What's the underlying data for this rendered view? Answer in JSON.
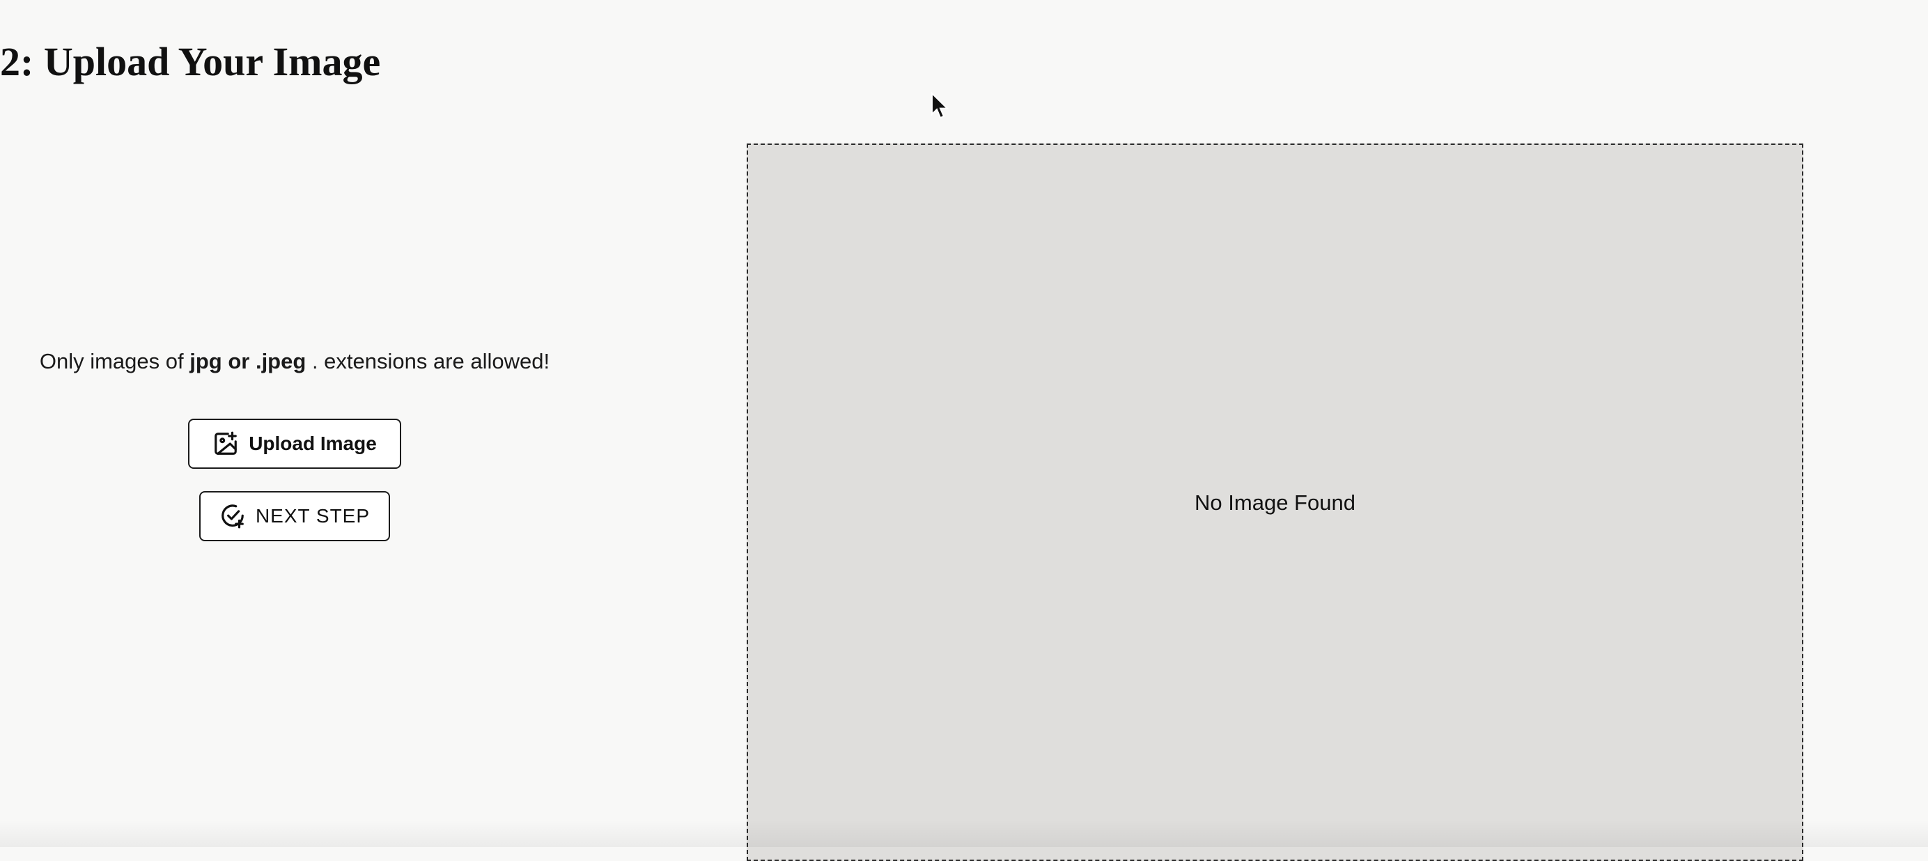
{
  "header": {
    "title": "2: Upload Your Image"
  },
  "upload_panel": {
    "note_prefix": "Only images of",
    "note_bold": "jpg or .jpeg",
    "note_suffix": ". extensions are allowed!",
    "upload_button_label": "Upload Image",
    "upload_button_icon": "image-plus-icon",
    "next_button_label": "NEXT STEP",
    "next_button_icon": "check-circle-plus-icon"
  },
  "preview": {
    "empty_text": "No Image Found"
  },
  "colors": {
    "page_background": "#f8f8f7",
    "preview_background": "#dfdedc",
    "button_background": "#ffffff",
    "border": "#1b1b1b"
  }
}
